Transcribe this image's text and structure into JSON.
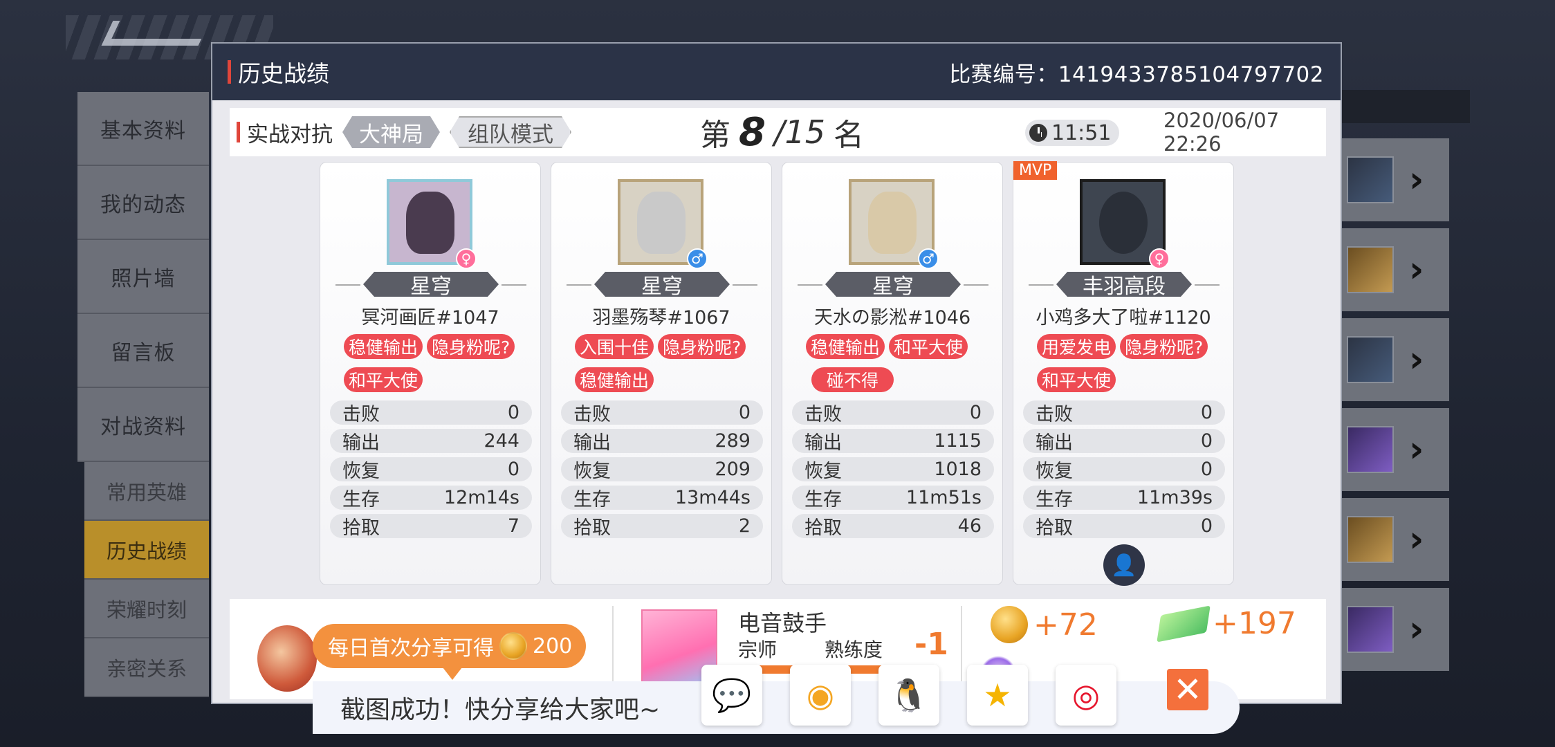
{
  "left_menu": {
    "items": [
      "基本资料",
      "我的动态",
      "照片墙",
      "留言板",
      "对战资料"
    ],
    "sub_items": [
      "常用英雄",
      "历史战绩",
      "荣耀时刻",
      "亲密关系"
    ],
    "active_sub": "历史战绩"
  },
  "modal": {
    "title": "历史战绩",
    "match_id": "比赛编号：1419433785104797702"
  },
  "match": {
    "mode": "实战对抗",
    "tag_level": "大神局",
    "tag_mode": "组队模式",
    "rank_prefix": "第",
    "rank_num": "8",
    "rank_total": "/15",
    "rank_suffix": "名",
    "duration": "11:51",
    "datetime": "2020/06/07 22:26"
  },
  "stat_labels": [
    "击败",
    "输出",
    "恢复",
    "生存",
    "拾取"
  ],
  "players": [
    {
      "rank": "星穹",
      "name": "冥河画匠#1047",
      "gender": "♀",
      "tags": [
        "稳健输出",
        "隐身粉呢?",
        "和平大使"
      ],
      "stats": [
        "0",
        "244",
        "0",
        "12m14s",
        "7"
      ]
    },
    {
      "rank": "星穹",
      "name": "羽墨殇琴#1067",
      "gender": "♂",
      "tags": [
        "入围十佳",
        "隐身粉呢?",
        "稳健输出"
      ],
      "stats": [
        "0",
        "289",
        "209",
        "13m44s",
        "2"
      ]
    },
    {
      "rank": "星穹",
      "name": "天水の影淞#1046",
      "gender": "♂",
      "tags": [
        "稳健输出",
        "和平大使",
        "碰不得"
      ],
      "stats": [
        "0",
        "1115",
        "1018",
        "11m51s",
        "46"
      ]
    },
    {
      "mvp": "MVP",
      "rank": "丰羽高段",
      "name": "小鸡多大了啦#1120",
      "gender": "♀",
      "tags": [
        "用爱发电",
        "隐身粉呢?",
        "和平大使"
      ],
      "stats": [
        "0",
        "0",
        "0",
        "11m39s",
        "0"
      ]
    }
  ],
  "bottom": {
    "share_reward_text": "每日首次分享可得",
    "share_reward_amount": "200",
    "hero_name": "电音鼓手",
    "hero_rank": "宗师",
    "proficiency_label": "熟练度",
    "proficiency_delta": "-1",
    "gold_reward": "+72",
    "gem_reward": "+197"
  },
  "share_toast": {
    "text": "截图成功！快分享给大家吧~",
    "buttons": [
      "wechat-icon",
      "moments-icon",
      "qq-icon",
      "qzone-icon",
      "weibo-icon"
    ]
  },
  "colors": {
    "accent_red": "#e0463b",
    "tag_red": "#ee4b53",
    "orange": "#f07a2f",
    "header_navy": "#2b3347",
    "active_gold": "#b98f2a"
  }
}
